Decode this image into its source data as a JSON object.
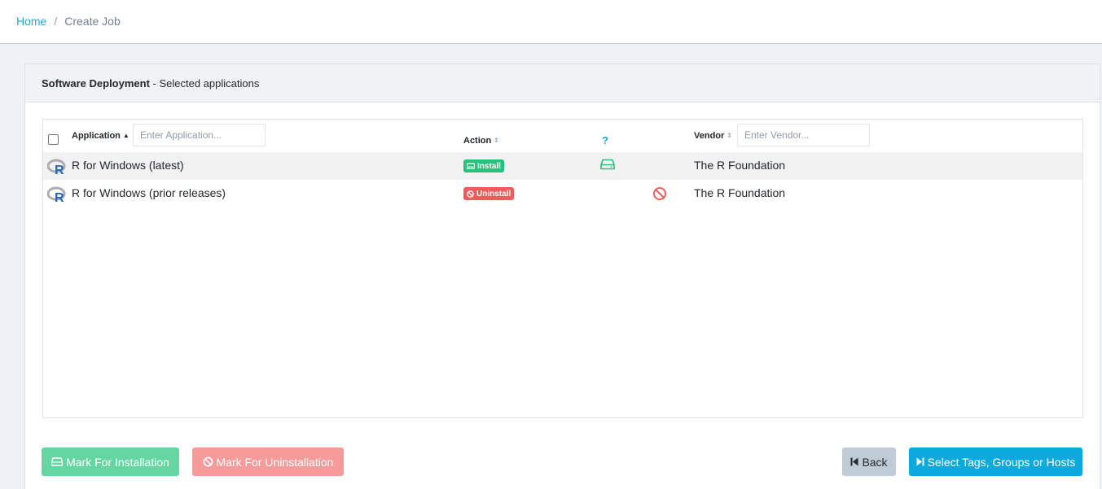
{
  "breadcrumb": {
    "home": "Home",
    "separator": "/",
    "current": "Create Job"
  },
  "card": {
    "title_bold": "Software Deployment",
    "title_rest": " - Selected applications"
  },
  "table": {
    "columns": {
      "application": "Application",
      "action": "Action",
      "help": "?",
      "vendor": "Vendor"
    },
    "filters": {
      "application_placeholder": "Enter Application...",
      "vendor_placeholder": "Enter Vendor..."
    },
    "rows": [
      {
        "name": "R for Windows (latest)",
        "action": "Install",
        "vendor": "The R Foundation",
        "status_icon": "hard-drive-icon"
      },
      {
        "name": "R for Windows (prior releases)",
        "action": "Uninstall",
        "vendor": "The R Foundation",
        "status_icon": "ban-icon"
      }
    ]
  },
  "buttons": {
    "mark_install": "Mark For Installation",
    "mark_uninstall": "Mark For Uninstallation",
    "back": "Back",
    "next": "Select Tags, Groups or Hosts"
  },
  "colors": {
    "accent": "#20a8d8",
    "install": "#28c07b",
    "uninstall": "#f25b5b"
  }
}
